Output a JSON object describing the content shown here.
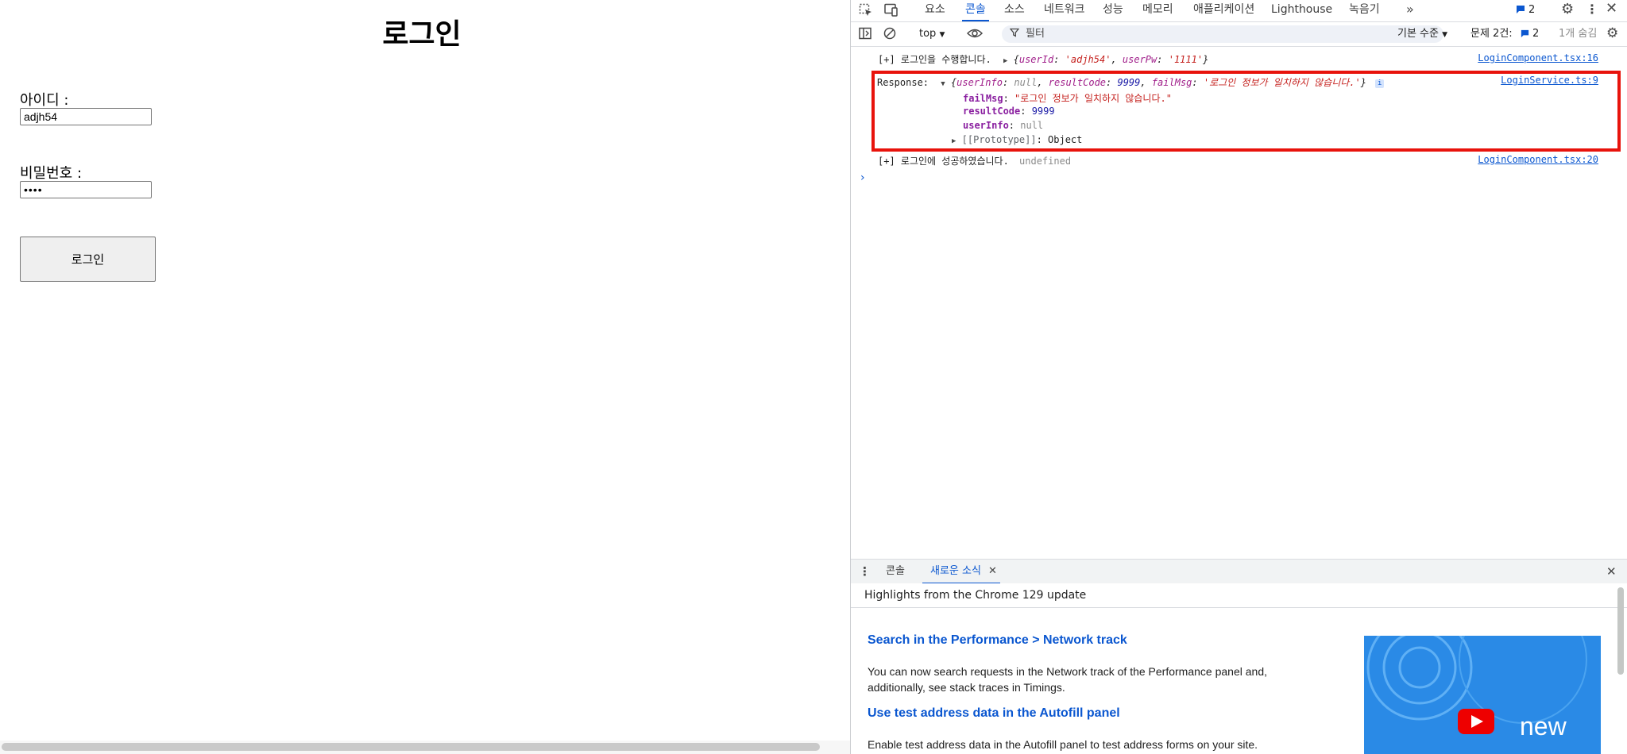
{
  "page": {
    "title": "로그인",
    "id_label": "아이디 :",
    "id_value": "adjh54",
    "pw_label": "비밀번호 :",
    "pw_value": "••••",
    "login_button": "로그인"
  },
  "devtools": {
    "tabs": [
      "요소",
      "콘솔",
      "소스",
      "네트워크",
      "성능",
      "메모리",
      "애플리케이션",
      "Lighthouse",
      "녹음기"
    ],
    "active_tab": "콘솔",
    "issues_count": "2",
    "toolbar": {
      "context": "top",
      "filter_placeholder": "필터",
      "level": "기본 수준",
      "issues_label": "문제 2건:",
      "issues_badge": "2",
      "hidden": "1개 숨김"
    },
    "console": {
      "line1": {
        "prefix": "[+] 로그인을 수행합니다.",
        "obj_open": "{",
        "k1": "userId",
        "v1": "'adjh54'",
        "k2": "userPw",
        "v2": "'1111'",
        "obj_close": "}",
        "source": "LoginComponent.tsx:16"
      },
      "response": {
        "label": "Response:",
        "k1": "userInfo",
        "v1": "null",
        "k2": "resultCode",
        "v2": "9999",
        "k3": "failMsg",
        "v3": "'로그인 정보가 일치하지 않습니다.'",
        "source": "LoginService.ts:9",
        "props": [
          {
            "key": "failMsg",
            "value": "\"로그인 정보가 일치하지 않습니다.\""
          },
          {
            "key": "resultCode",
            "value": "9999"
          },
          {
            "key": "userInfo",
            "value": "null"
          }
        ],
        "prototype_key": "[[Prototype]]",
        "prototype_value": "Object"
      },
      "line3": {
        "prefix": "[+] 로그인에 성공하였습니다.",
        "value": "undefined",
        "source": "LoginComponent.tsx:20"
      }
    },
    "drawer": {
      "tabs": [
        "콘솔",
        "새로운 소식"
      ],
      "active_tab": "새로운 소식",
      "header": "Highlights from the Chrome 129 update",
      "items": [
        {
          "title": "Search in the Performance > Network track",
          "body": "You can now search requests in the Network track of the Performance panel and, additionally, see stack traces in Timings."
        },
        {
          "title": "Use test address data in the Autofill panel",
          "body": "Enable test address data in the Autofill panel to test address forms on your site."
        }
      ],
      "promo_text": "new"
    }
  },
  "colors": {
    "accent": "#0b57d0",
    "highlight_border": "#e8130c",
    "string": "#c5221f",
    "number": "#1a1aa6"
  }
}
